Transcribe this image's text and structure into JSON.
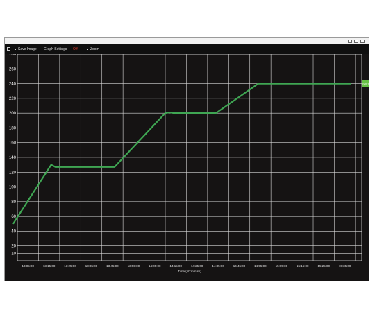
{
  "window": {
    "controls": [
      "minimize",
      "maximize",
      "close"
    ]
  },
  "toolbar": {
    "save_image": "Save Image",
    "graph_settings": "Graph Settings",
    "red_item": "Off",
    "zoom": "Zoom",
    "red_color": "#e13b2a"
  },
  "current_value_label": "240.1",
  "colors": {
    "background": "#151313",
    "grid": "#d8d8d8",
    "line": "#3fa653",
    "tag": "#68c247"
  },
  "chart_data": {
    "type": "line",
    "xlabel": "Time (hh:mm:ss)",
    "ylabel": "",
    "ylim": [
      0,
      280
    ],
    "grid": true,
    "y_ticks": [
      10,
      20,
      40,
      60,
      80,
      100,
      120,
      140,
      160,
      180,
      200,
      220,
      240,
      260,
      280
    ],
    "x_tick_labels": [
      "13:05:00",
      "13:15:00",
      "13:25:00",
      "13:35:00",
      "13:45:00",
      "13:55:00",
      "14:05:00",
      "14:15:00",
      "14:25:00",
      "14:35:00",
      "14:45:00",
      "14:55:00",
      "15:05:00",
      "15:15:00",
      "15:25:00",
      "15:35:00"
    ],
    "series": [
      {
        "x": [
          "12:58:00",
          "13:16:00",
          "13:18:00",
          "13:20:00",
          "13:46:00",
          "14:10:00",
          "14:12:00",
          "14:14:00",
          "14:34:00",
          "14:54:00",
          "14:56:00",
          "15:38:00"
        ],
        "values": [
          50,
          130,
          127,
          127,
          127,
          200,
          201,
          200,
          200,
          240,
          240,
          240
        ]
      }
    ]
  }
}
